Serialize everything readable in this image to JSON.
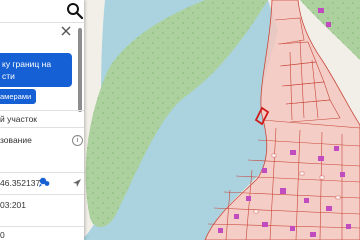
{
  "panel": {
    "title": "ку границ на",
    "title_line2": "сти",
    "primary_button_line1": "ку границ на",
    "primary_button_line2": "сти",
    "secondary_button": "амерами",
    "parcel_type": "й участок",
    "field_label": "зование",
    "coord_value": "46.352137",
    "area_value": "03:201",
    "bottom_value": "0"
  },
  "icons": {
    "search": "search-icon",
    "close": "close-icon",
    "chat": "chat-bubble-icon",
    "info": "info-icon",
    "navigate": "navigate-icon"
  },
  "colors": {
    "water": "#aad3df",
    "land": "#f2efe9",
    "forest": "#add19e",
    "cadastral_fill": "#f4c7c0",
    "cadastral_line": "#c8463a",
    "selected": "#d11b1b",
    "button": "#1560d4",
    "building": "#c04cc0"
  }
}
